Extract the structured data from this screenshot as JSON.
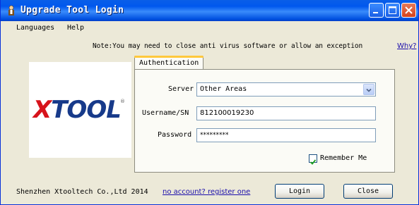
{
  "window": {
    "title": "Upgrade Tool Login"
  },
  "menu": {
    "items": [
      "Languages",
      "Help"
    ]
  },
  "note": {
    "text": "Note:You may need to close anti virus software or allow an exception",
    "why_link": "Why?"
  },
  "logo": {
    "letter_x": "X",
    "rest": "TOOL",
    "reg_mark": "®"
  },
  "tabs": [
    {
      "label": "Authentication",
      "active": true
    }
  ],
  "form": {
    "server_label": "Server",
    "server_value": "Other Areas",
    "username_label": "Username/SN",
    "username_value": "812100019230",
    "password_label": "Password",
    "password_mask": "*********",
    "remember_label": "Remember Me",
    "remember_checked": true
  },
  "footer": {
    "company": "Shenzhen Xtooltech Co.,Ltd 2014",
    "register_link": "no account? register one",
    "login_button": "Login",
    "close_button": "Close"
  },
  "colors": {
    "titlebar": "#0058ee",
    "dialog_bg": "#ece9d8",
    "link": "#1a0dab",
    "logo_red": "#d7131b",
    "logo_blue": "#173a8a"
  },
  "icons": {
    "app": "app-person-icon",
    "minimize": "minimize-icon",
    "maximize": "maximize-icon",
    "close": "close-icon",
    "dropdown": "chevron-down-icon",
    "check": "checkmark-icon"
  }
}
